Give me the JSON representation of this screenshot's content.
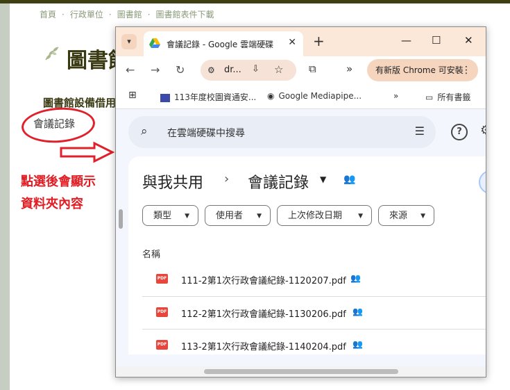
{
  "site": {
    "breadcrumb": [
      "首頁",
      "行政單位",
      "圖書館",
      "圖書館表件下載"
    ],
    "title": "圖書館",
    "subheading": "圖書館設備借用",
    "folder_link": "會議記錄",
    "note_line1": "點選後會顯示",
    "note_line2": "資料夾內容",
    "annotation_color": "#e21c23"
  },
  "browser": {
    "tab_title": "會議記錄 - Google 雲端硬碟",
    "url": "dr...",
    "update_button": "有新版 Chrome 可安裝",
    "bookmarks": [
      "113年度校園資通安...",
      "Google Mediapipe...",
      "所有書籤"
    ],
    "icons": [
      "tab-search-icon",
      "drive-favicon",
      "close-icon",
      "new-tab-icon",
      "minimize-icon",
      "maximize-icon",
      "back-icon",
      "forward-icon",
      "reload-icon",
      "site-settings-icon",
      "install-icon",
      "star-icon",
      "extensions-icon",
      "apps-icon",
      "folder-icon"
    ]
  },
  "drive": {
    "search_placeholder": "在雲端硬碟中搜尋",
    "breadcrumb_root": "與我共用",
    "breadcrumb_current": "會議記錄",
    "filters": [
      "類型",
      "使用者",
      "上次修改日期",
      "來源"
    ],
    "column_name": "名稱",
    "file_icon_label": "PDF",
    "files": [
      "111-2第1次行政會議紀錄-1120207.pdf",
      "112-2第1次行政會議紀錄-1130206.pdf",
      "113-2第1次行政會議紀錄-1140204.pdf"
    ]
  }
}
